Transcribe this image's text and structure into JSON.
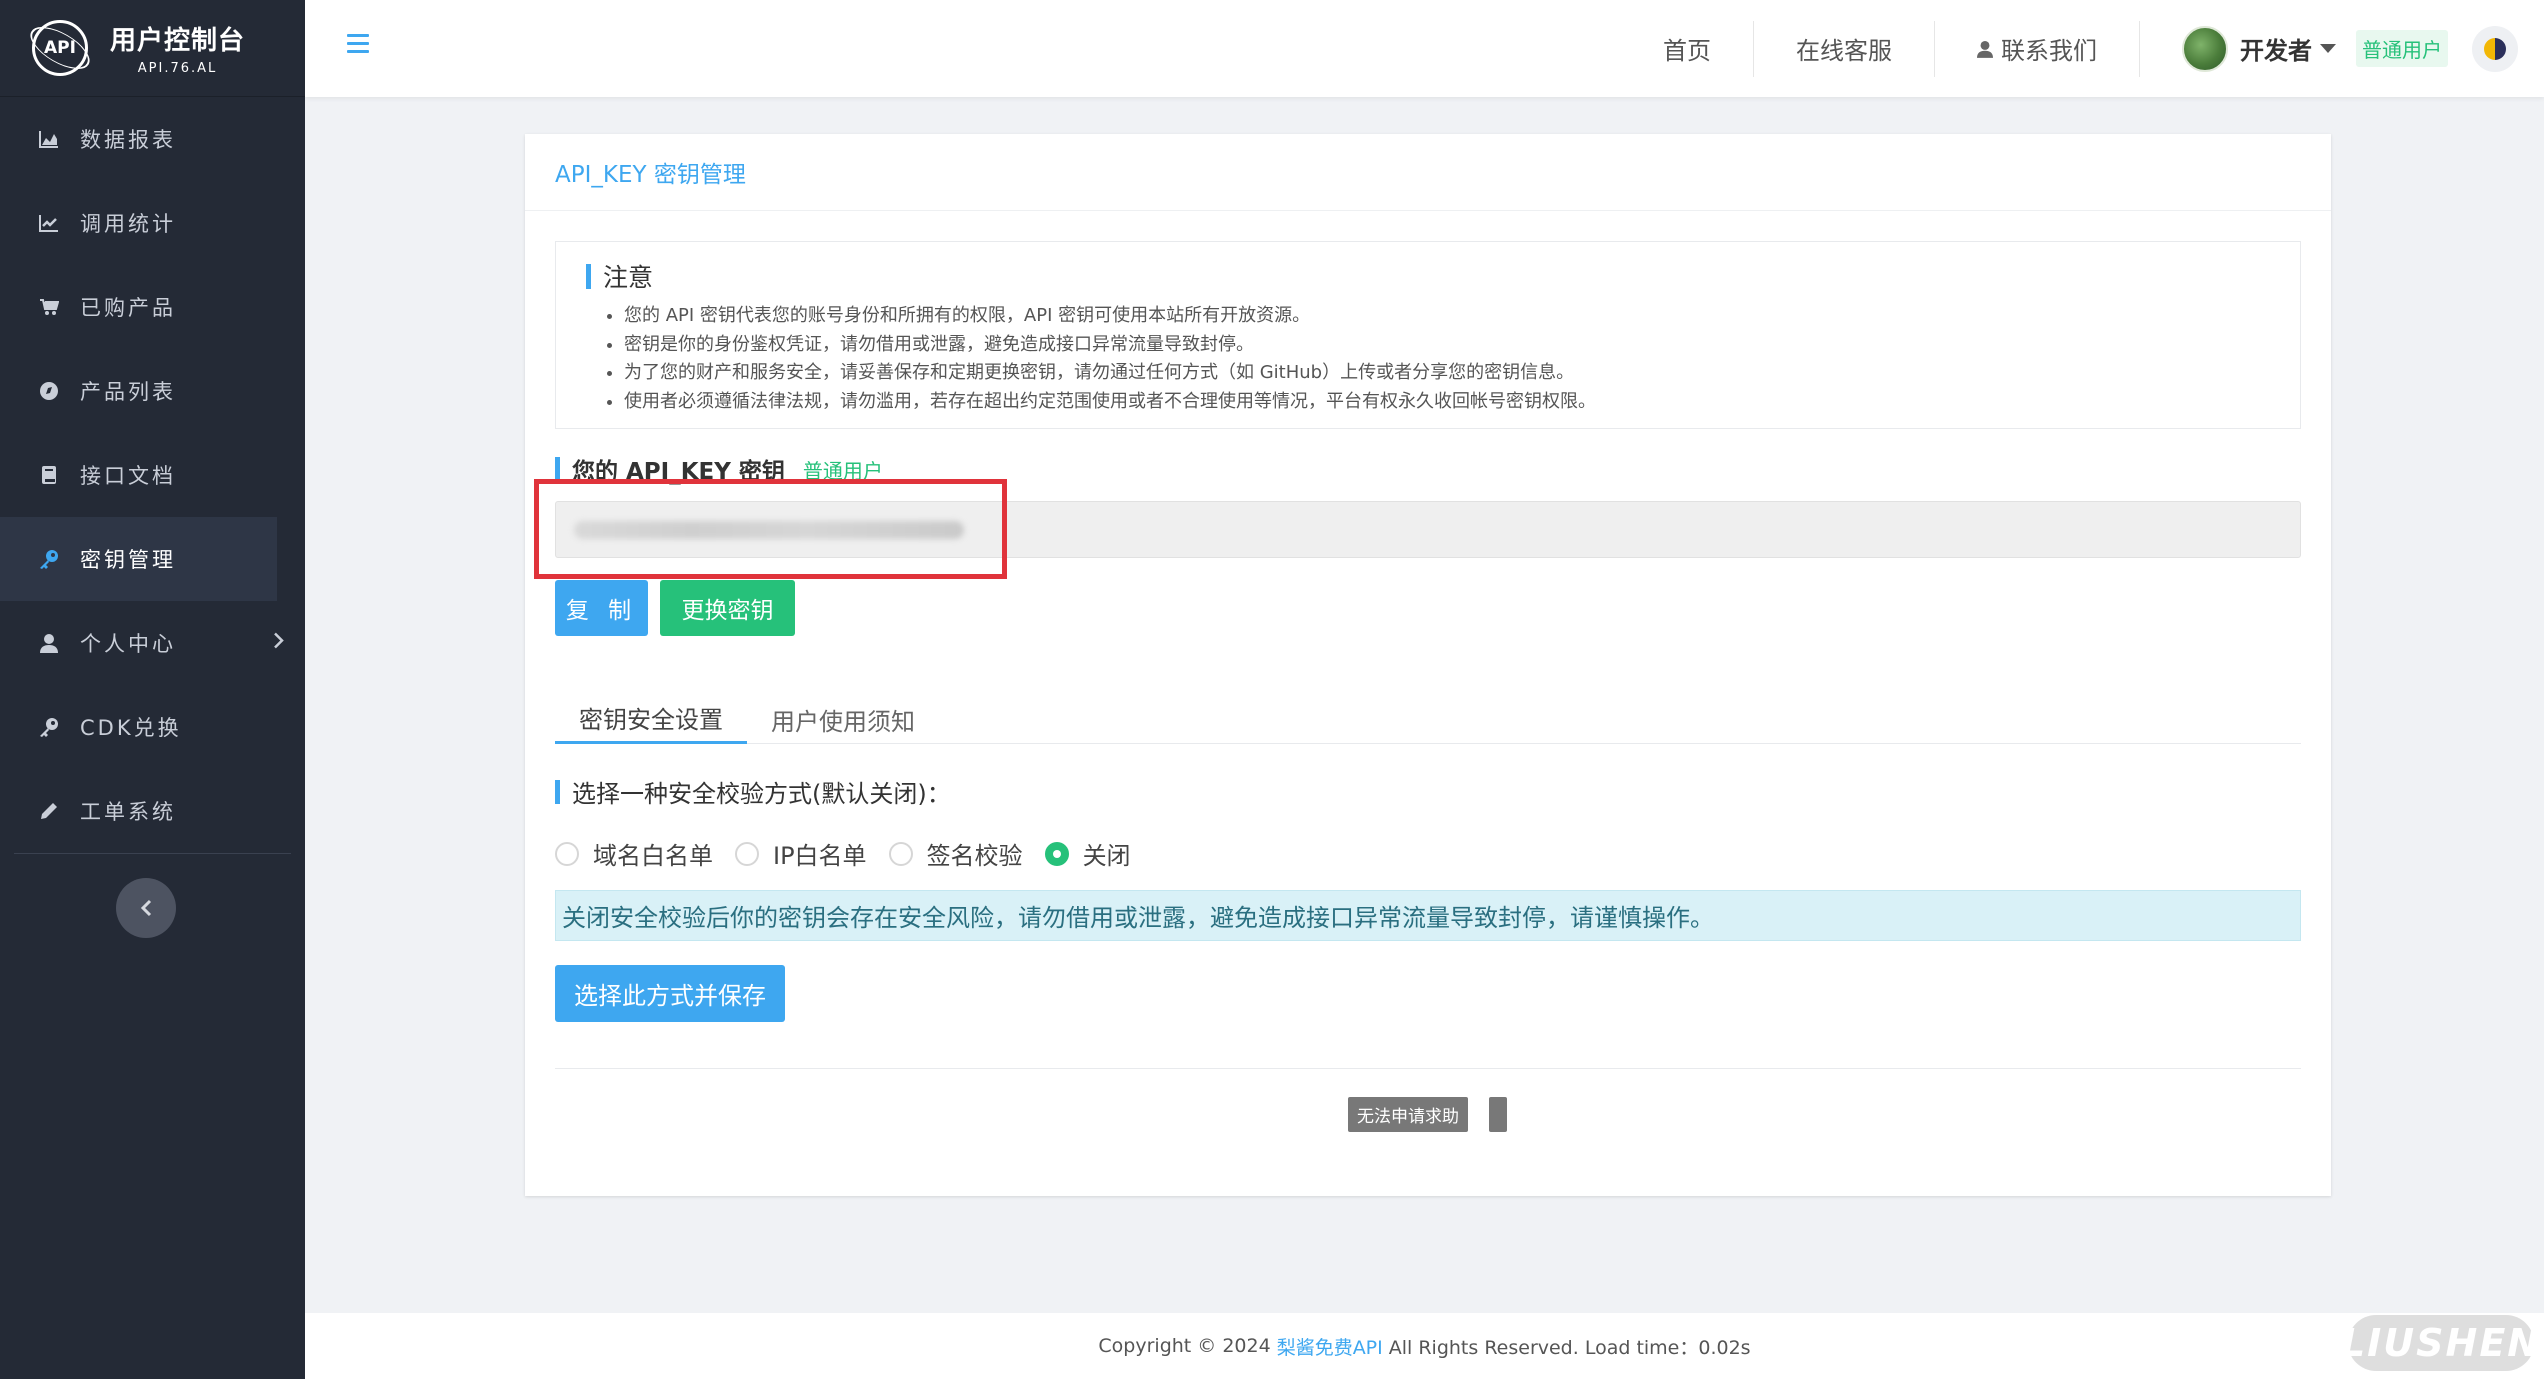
{
  "brand": {
    "logo_text": "API",
    "title": "用户控制台",
    "subtitle": "API.76.AL"
  },
  "sidebar": {
    "items": [
      {
        "label": "数据报表",
        "icon": "area-chart-icon"
      },
      {
        "label": "调用统计",
        "icon": "line-chart-icon"
      },
      {
        "label": "已购产品",
        "icon": "cart-icon"
      },
      {
        "label": "产品列表",
        "icon": "compass-icon"
      },
      {
        "label": "接口文档",
        "icon": "book-icon"
      },
      {
        "label": "密钥管理",
        "icon": "key-icon",
        "active": true
      },
      {
        "label": "个人中心",
        "icon": "user-icon",
        "has_submenu": true
      },
      {
        "label": "CDK兑换",
        "icon": "key-icon"
      },
      {
        "label": "工单系统",
        "icon": "pencil-icon"
      }
    ]
  },
  "header": {
    "links": [
      "首页",
      "在线客服",
      "联系我们"
    ],
    "user": {
      "name": "开发者",
      "badge": "普通用户"
    }
  },
  "card": {
    "title": "API_KEY 密钥管理",
    "notice": {
      "title": "注意",
      "items": [
        "您的 API 密钥代表您的账号身份和所拥有的权限，API 密钥可使用本站所有开放资源。",
        "密钥是你的身份鉴权凭证，请勿借用或泄露，避免造成接口异常流量导致封停。",
        "为了您的财产和服务安全，请妥善保存和定期更换密钥，请勿通过任何方式（如 GitHub）上传或者分享您的密钥信息。",
        "使用者必须遵循法律法规，请勿滥用，若存在超出约定范围使用或者不合理使用等情况，平台有权永久收回帐号密钥权限。"
      ]
    },
    "key_section": {
      "label": "您的 API_KEY 密钥",
      "tag": "普通用户"
    },
    "buttons": {
      "copy": "复 制",
      "change": "更换密钥",
      "save": "选择此方式并保存"
    },
    "tabs": [
      "密钥安全设置",
      "用户使用须知"
    ],
    "method_label": "选择一种安全校验方式(默认关闭)：",
    "radios": [
      {
        "label": "域名白名单",
        "checked": false
      },
      {
        "label": "IP白名单",
        "checked": false
      },
      {
        "label": "签名校验",
        "checked": false
      },
      {
        "label": "关闭",
        "checked": true
      }
    ],
    "alert": "关闭安全校验后你的密钥会存在安全风险，请勿借用或泄露，避免造成接口异常流量导致封停，请谨慎操作。",
    "help_label": "无法申请求助"
  },
  "footer": {
    "prefix": "Copyright © 2024",
    "link": "梨酱免费API",
    "suffix": "All Rights Reserved. Load time：0.02s"
  },
  "watermark": "LIUSHEN",
  "colors": {
    "accent": "#3ea7f0",
    "success": "#26c17a",
    "sidebar_bg": "#242a36",
    "highlight": "#e0333b"
  }
}
